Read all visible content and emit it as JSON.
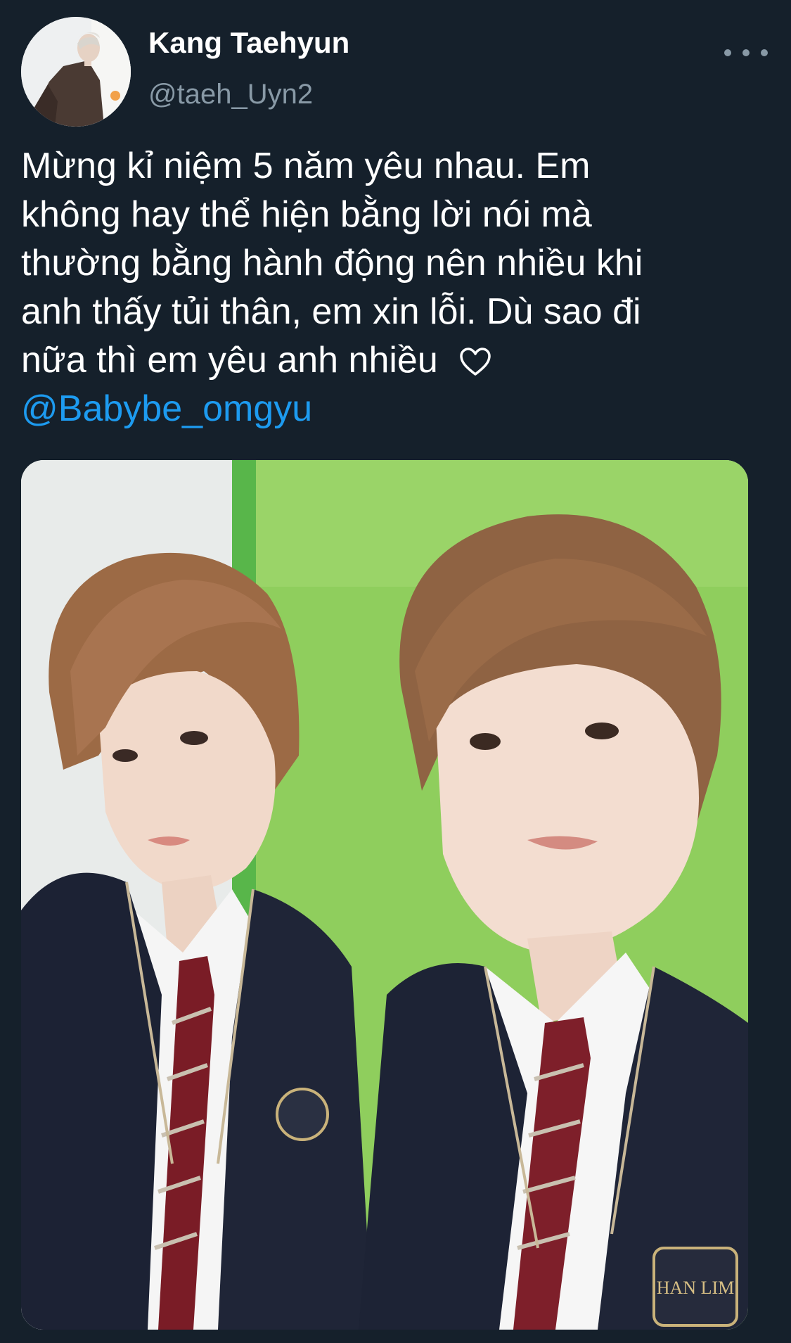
{
  "user": {
    "display_name": "Kang Taehyun",
    "handle": "@taeh_Uyn2",
    "avatar_icon": "avatar-icon"
  },
  "actions": {
    "more_icon": "more-icon"
  },
  "tweet": {
    "lines": [
      "Mừng kỉ niệm 5 năm yêu nhau. Em",
      "không hay thể hiện bằng lời nói mà",
      "thường bằng hành động nên nhiều khi",
      "anh thấy tủi thân, em xin lỗi. Dù sao đi",
      "nữa thì em yêu anh nhiều"
    ],
    "heart_icon": "heart-icon",
    "mention": "@Babybe_omgyu"
  },
  "media": {
    "description_icon": "photo-icon",
    "badge_text": "HAN LIM"
  },
  "colors": {
    "background": "#15202b",
    "text": "#ffffff",
    "secondary_text": "#8899a6",
    "link": "#1d9bf0"
  }
}
